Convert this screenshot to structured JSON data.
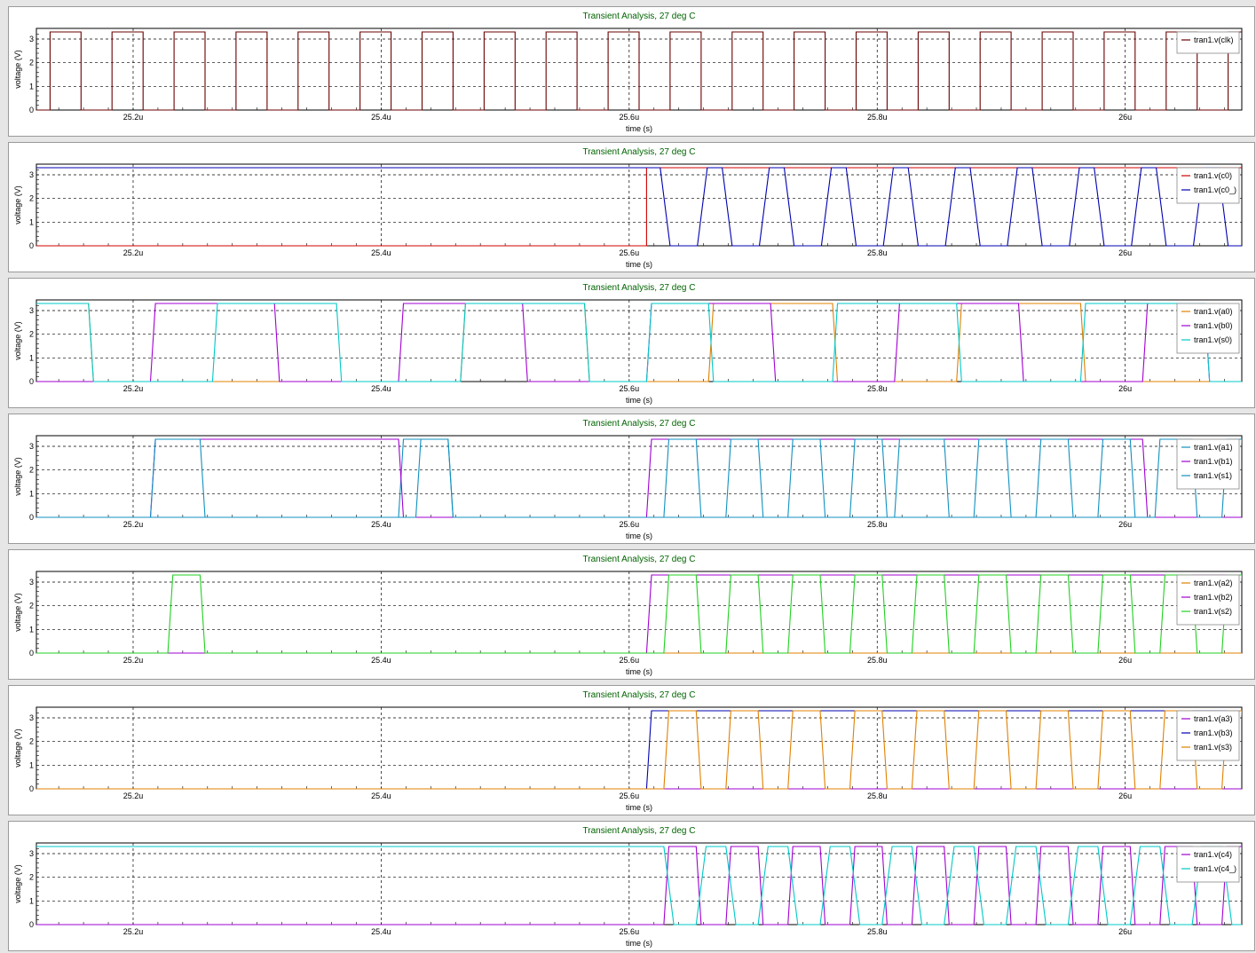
{
  "colors": {
    "title": "#006400",
    "clk": "#6b0000",
    "red": "#d00000",
    "blue": "#0000b0",
    "orange": "#e08000",
    "purple": "#a000d0",
    "cyan": "#00c8c8",
    "teal": "#1090c0",
    "green": "#20d020",
    "grid": "#000000",
    "panel_bg": "#ffffff",
    "panel_border": "#9a9a9a"
  },
  "chart_data": [
    {
      "type": "line",
      "title": "Transient Analysis, 27 deg C",
      "xlabel": "time (s)",
      "ylabel": "voltage (V)",
      "xlim": [
        25.122,
        25.0,
        0
      ],
      "ylim": [
        0,
        3.3
      ],
      "xticks": [
        "25.2u",
        "25.4u",
        "25.6u",
        "25.8u",
        "26u"
      ],
      "yticks": [
        "0",
        "1",
        "2",
        "3"
      ],
      "grid": true,
      "legend": "top-right",
      "series": [
        {
          "name": "tran1.v(clk)",
          "color": "clk",
          "kind": "clock"
        }
      ]
    },
    {
      "type": "line",
      "title": "Transient Analysis, 27 deg C",
      "xlabel": "time (s)",
      "ylabel": "voltage (V)",
      "ylim": [
        0,
        3.3
      ],
      "xticks": [
        "25.2u",
        "25.4u",
        "25.6u",
        "25.8u",
        "26u"
      ],
      "yticks": [
        "0",
        "1",
        "2",
        "3"
      ],
      "grid": true,
      "legend": "top-right",
      "series": [
        {
          "name": "tran1.v(c0)",
          "color": "red",
          "kind": "step",
          "edges": [
            [
              25.122,
              0
            ],
            [
              25.614,
              3.3
            ]
          ]
        },
        {
          "name": "tran1.v(c0_)",
          "color": "blue",
          "kind": "pulses",
          "base": 3.3,
          "high_until": 25.625,
          "pulses": [
            [
              25.655,
              25.675
            ],
            [
              25.705,
              25.725
            ],
            [
              25.755,
              25.775
            ],
            [
              25.805,
              25.825
            ],
            [
              25.855,
              25.875
            ],
            [
              25.905,
              25.925
            ],
            [
              25.955,
              25.975
            ],
            [
              26.005,
              26.025
            ],
            [
              26.055,
              26.075
            ]
          ]
        }
      ]
    },
    {
      "type": "line",
      "title": "Transient Analysis, 27 deg C",
      "xlabel": "time (s)",
      "ylabel": "voltage (V)",
      "ylim": [
        0,
        3.3
      ],
      "xticks": [
        "25.2u",
        "25.4u",
        "25.6u",
        "25.8u",
        "26u"
      ],
      "yticks": [
        "0",
        "1",
        "2",
        "3"
      ],
      "grid": true,
      "legend": "top-right",
      "series": [
        {
          "name": "tran1.v(a0)",
          "color": "orange",
          "kind": "pulses",
          "pulses": [
            [
              25.122,
              25.164
            ],
            [
              25.464,
              25.564
            ],
            [
              25.664,
              25.764
            ],
            [
              25.864,
              25.964
            ]
          ]
        },
        {
          "name": "tran1.v(b0)",
          "color": "purple",
          "kind": "pulses",
          "pulses": [
            [
              25.214,
              25.314
            ],
            [
              25.414,
              25.514
            ],
            [
              25.614,
              25.714
            ],
            [
              25.814,
              25.914
            ],
            [
              26.014,
              26.064
            ]
          ]
        },
        {
          "name": "tran1.v(s0)",
          "color": "cyan",
          "kind": "pulses",
          "pulses": [
            [
              25.122,
              25.164
            ],
            [
              25.264,
              25.364
            ],
            [
              25.464,
              25.564
            ],
            [
              25.614,
              25.664
            ],
            [
              25.764,
              25.864
            ],
            [
              25.964,
              26.064
            ]
          ]
        }
      ]
    },
    {
      "type": "line",
      "title": "Transient Analysis, 27 deg C",
      "xlabel": "time (s)",
      "ylabel": "voltage (V)",
      "ylim": [
        0,
        3.3
      ],
      "xticks": [
        "25.2u",
        "25.4u",
        "25.6u",
        "25.8u",
        "26u"
      ],
      "yticks": [
        "0",
        "1",
        "2",
        "3"
      ],
      "grid": true,
      "legend": "top-right",
      "series": [
        {
          "name": "tran1.v(a1)",
          "color": "teal",
          "kind": "pulses",
          "pulses": [
            [
              25.414,
              25.454
            ]
          ]
        },
        {
          "name": "tran1.v(b1)",
          "color": "purple",
          "kind": "pulses",
          "pulses": [
            [
              25.214,
              25.414
            ],
            [
              25.614,
              26.014
            ]
          ]
        },
        {
          "name": "tran1.v(s1)",
          "color": "teal",
          "kind": "pulses",
          "pulses": [
            [
              25.214,
              25.254
            ],
            [
              25.428,
              25.454
            ],
            [
              25.628,
              25.654
            ],
            [
              25.678,
              25.704
            ],
            [
              25.728,
              25.754
            ],
            [
              25.778,
              25.804
            ],
            [
              25.814,
              25.854
            ],
            [
              25.878,
              25.904
            ],
            [
              25.928,
              25.954
            ],
            [
              25.978,
              26.004
            ],
            [
              26.024,
              26.054
            ],
            [
              26.078,
              26.094
            ]
          ]
        }
      ]
    },
    {
      "type": "line",
      "title": "Transient Analysis, 27 deg C",
      "xlabel": "time (s)",
      "ylabel": "voltage (V)",
      "ylim": [
        0,
        3.3
      ],
      "xticks": [
        "25.2u",
        "25.4u",
        "25.6u",
        "25.8u",
        "26u"
      ],
      "yticks": [
        "0",
        "1",
        "2",
        "3"
      ],
      "grid": true,
      "legend": "top-right",
      "series": [
        {
          "name": "tran1.v(a2)",
          "color": "orange",
          "kind": "pulses",
          "pulses": []
        },
        {
          "name": "tran1.v(b2)",
          "color": "purple",
          "kind": "pulses",
          "pulses": [
            [
              25.614,
              26.094
            ]
          ]
        },
        {
          "name": "tran1.v(s2)",
          "color": "green",
          "kind": "pulses",
          "pulses": [
            [
              25.228,
              25.254
            ],
            [
              25.628,
              25.654
            ],
            [
              25.678,
              25.704
            ],
            [
              25.728,
              25.754
            ],
            [
              25.778,
              25.804
            ],
            [
              25.828,
              25.854
            ],
            [
              25.878,
              25.904
            ],
            [
              25.928,
              25.954
            ],
            [
              25.978,
              26.004
            ],
            [
              26.028,
              26.054
            ],
            [
              26.078,
              26.094
            ]
          ]
        }
      ]
    },
    {
      "type": "line",
      "title": "Transient Analysis, 27 deg C",
      "xlabel": "time (s)",
      "ylabel": "voltage (V)",
      "ylim": [
        0,
        3.3
      ],
      "xticks": [
        "25.2u",
        "25.4u",
        "25.6u",
        "25.8u",
        "26u"
      ],
      "yticks": [
        "0",
        "1",
        "2",
        "3"
      ],
      "grid": true,
      "legend": "top-right",
      "series": [
        {
          "name": "tran1.v(a3)",
          "color": "purple",
          "kind": "pulses",
          "pulses": []
        },
        {
          "name": "tran1.v(b3)",
          "color": "blue",
          "kind": "pulses",
          "pulses": [
            [
              25.614,
              26.094
            ]
          ]
        },
        {
          "name": "tran1.v(s3)",
          "color": "orange",
          "kind": "pulses",
          "pulses": [
            [
              25.628,
              25.654
            ],
            [
              25.678,
              25.704
            ],
            [
              25.728,
              25.754
            ],
            [
              25.778,
              25.804
            ],
            [
              25.828,
              25.854
            ],
            [
              25.878,
              25.904
            ],
            [
              25.928,
              25.954
            ],
            [
              25.978,
              26.004
            ],
            [
              26.028,
              26.054
            ],
            [
              26.078,
              26.094
            ]
          ]
        }
      ]
    },
    {
      "type": "line",
      "title": "Transient Analysis, 27 deg C",
      "xlabel": "time (s)",
      "ylabel": "voltage (V)",
      "ylim": [
        0,
        3.3
      ],
      "xticks": [
        "25.2u",
        "25.4u",
        "25.6u",
        "25.8u",
        "26u"
      ],
      "yticks": [
        "0",
        "1",
        "2",
        "3"
      ],
      "grid": true,
      "legend": "top-right",
      "series": [
        {
          "name": "tran1.v(c4)",
          "color": "purple",
          "kind": "pulses",
          "pulses": [
            [
              25.628,
              25.654
            ],
            [
              25.678,
              25.704
            ],
            [
              25.728,
              25.754
            ],
            [
              25.778,
              25.804
            ],
            [
              25.828,
              25.854
            ],
            [
              25.878,
              25.904
            ],
            [
              25.928,
              25.954
            ],
            [
              25.978,
              26.004
            ],
            [
              26.028,
              26.054
            ],
            [
              26.078,
              26.094
            ]
          ]
        },
        {
          "name": "tran1.v(c4_)",
          "color": "cyan",
          "kind": "pulses",
          "base": 3.3,
          "high_until": 25.628,
          "pulses": [
            [
              25.654,
              25.678
            ],
            [
              25.704,
              25.728
            ],
            [
              25.754,
              25.778
            ],
            [
              25.804,
              25.828
            ],
            [
              25.854,
              25.878
            ],
            [
              25.904,
              25.928
            ],
            [
              25.954,
              25.978
            ],
            [
              26.004,
              26.028
            ],
            [
              26.054,
              26.078
            ]
          ]
        }
      ]
    }
  ]
}
